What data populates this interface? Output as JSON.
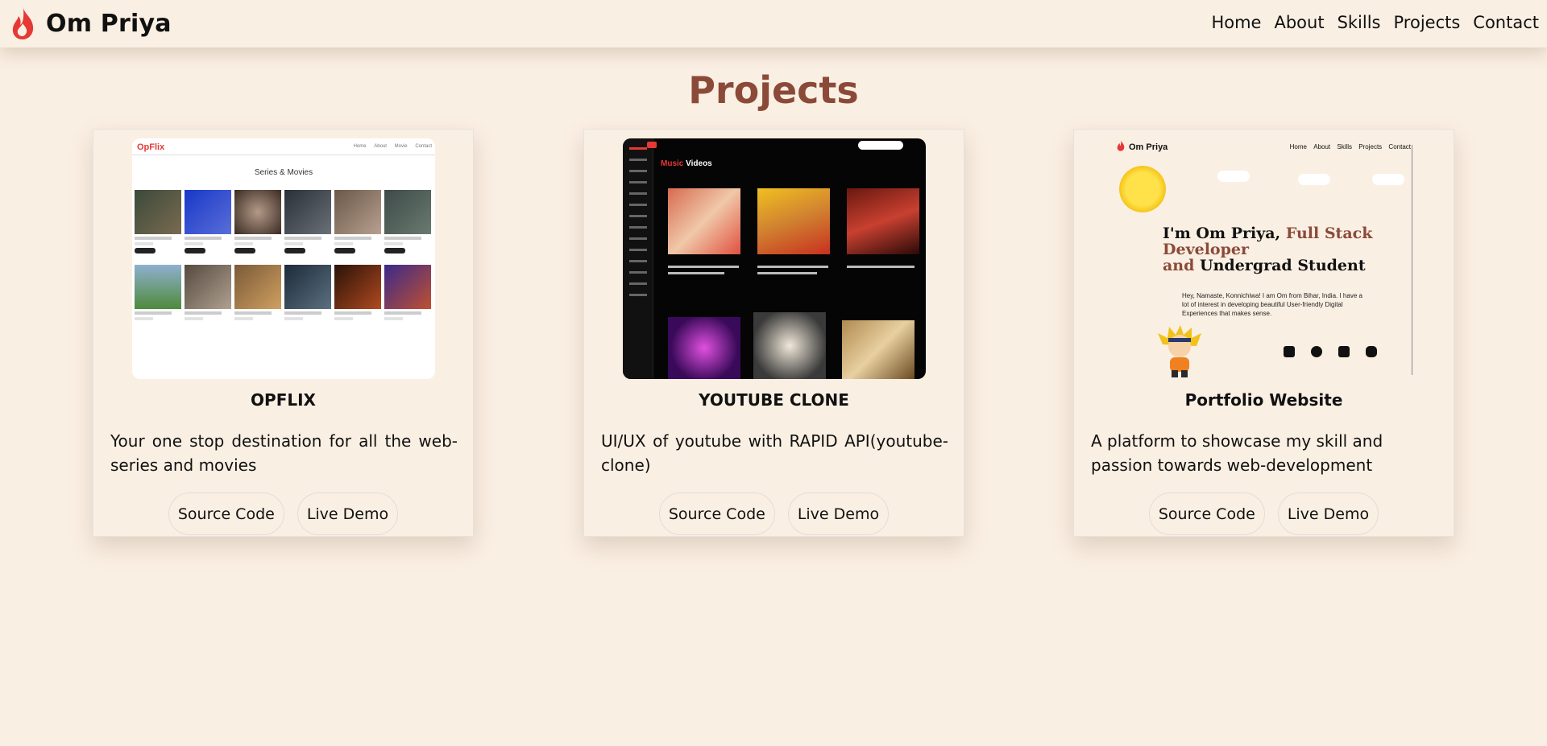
{
  "navbar": {
    "brand": "Om Priya",
    "links": [
      "Home",
      "About",
      "Skills",
      "Projects",
      "Contact"
    ]
  },
  "page": {
    "title": "Projects"
  },
  "colors": {
    "background": "#faefe3",
    "accent": "#8b4a39",
    "flame": "#e53935"
  },
  "projects": [
    {
      "title": "OPFLIX",
      "description": "Your one stop destination for all the web-series and movies",
      "source_label": "Source Code",
      "demo_label": "Live Demo",
      "screenshot": {
        "logo": "OpFlix",
        "nav": [
          "Home",
          "About",
          "Movie",
          "Contact"
        ],
        "heading": "Series & Movies"
      }
    },
    {
      "title": "YOUTUBE CLONE",
      "description": "UI/UX of youtube with RAPID API(youtube-clone)",
      "source_label": "Source Code",
      "demo_label": "Live Demo",
      "screenshot": {
        "heading_red": "Music",
        "heading_white": "Videos"
      }
    },
    {
      "title": "Portfolio Website",
      "description": "A platform to showcase my skill and passion towards web-development",
      "source_label": "Source Code",
      "demo_label": "Live Demo",
      "screenshot": {
        "brand": "Om Priya",
        "nav": [
          "Home",
          "About",
          "Skills",
          "Projects",
          "Contact"
        ],
        "headline_a": "I'm Om Priya,",
        "headline_b": "Full Stack Developer",
        "headline_c": "and",
        "headline_d": "Undergrad Student",
        "paragraph": "Hey, Namaste, Konnichiwa! I am Om from Bihar, India. I have a lot of interest in developing beautiful User-friendly Digital Experiences that makes sense."
      }
    }
  ]
}
